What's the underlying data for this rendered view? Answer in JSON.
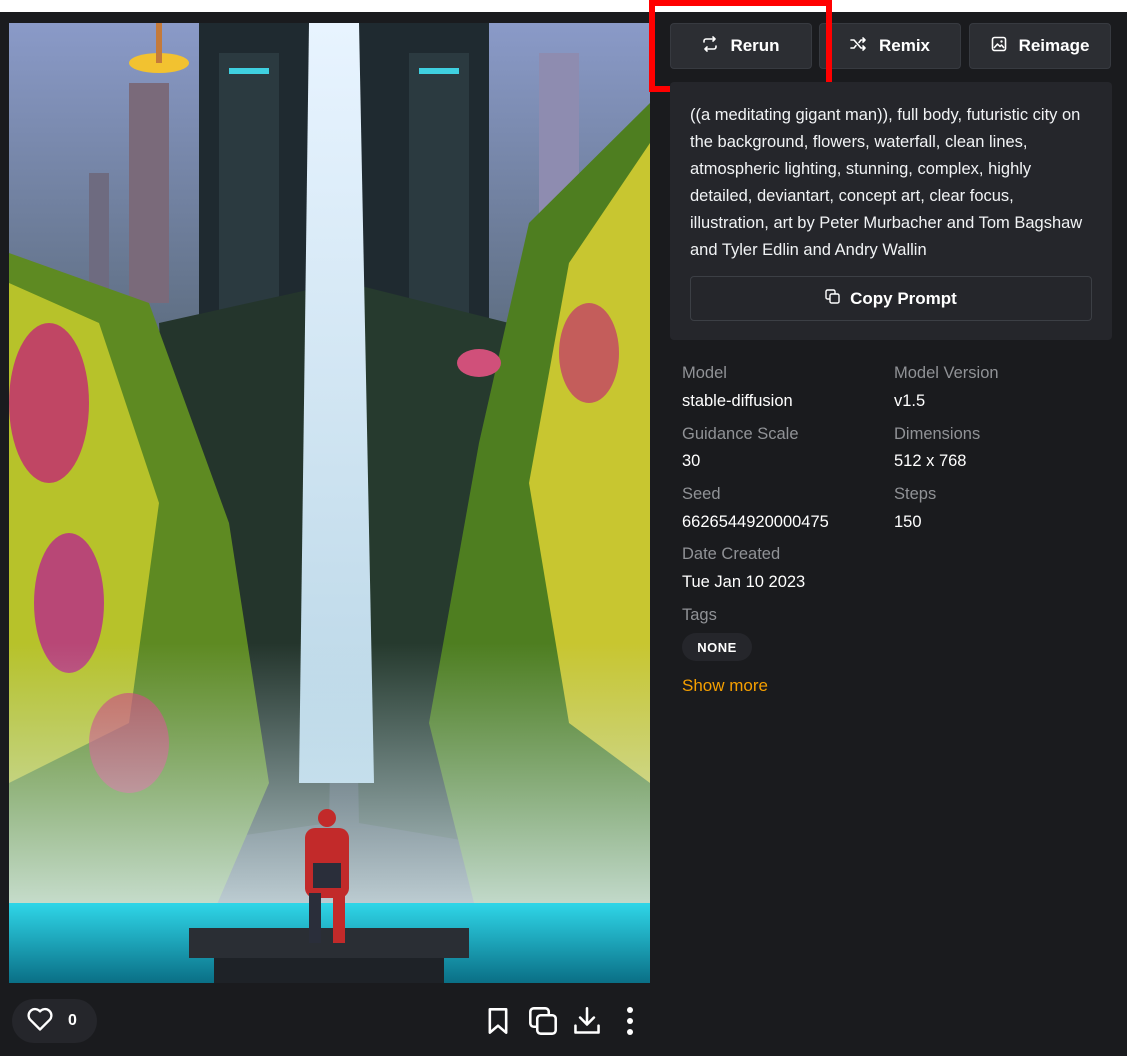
{
  "actions": {
    "rerun_label": "Rerun",
    "remix_label": "Remix",
    "reimage_label": "Reimage"
  },
  "prompt": {
    "text": "((a meditating gigant man)), full body, futuristic city on the background, flowers, waterfall, clean lines, atmospheric lighting, stunning, complex, highly detailed, deviantart, concept art, clear focus, illustration, art by Peter Murbacher and Tom Bagshaw and Tyler Edlin and Andry Wallin",
    "copy_label": "Copy Prompt"
  },
  "metadata": {
    "model_label": "Model",
    "model_value": "stable-diffusion",
    "model_version_label": "Model Version",
    "model_version_value": "v1.5",
    "guidance_label": "Guidance Scale",
    "guidance_value": "30",
    "dimensions_label": "Dimensions",
    "dimensions_value": "512 x 768",
    "seed_label": "Seed",
    "seed_value": "6626544920000475",
    "steps_label": "Steps",
    "steps_value": "150",
    "date_label": "Date Created",
    "date_value": "Tue Jan 10 2023",
    "tags_label": "Tags",
    "tags": [
      "NONE"
    ],
    "show_more_label": "Show more"
  },
  "bottom_bar": {
    "like_count": "0",
    "icons": [
      "heart-icon",
      "bookmark-icon",
      "copy-icon",
      "download-icon",
      "more-vertical-icon"
    ]
  },
  "colors": {
    "background": "#1a1b1e",
    "card": "#25262b",
    "accent_link": "#f59f00",
    "highlight": "#ff0000"
  }
}
